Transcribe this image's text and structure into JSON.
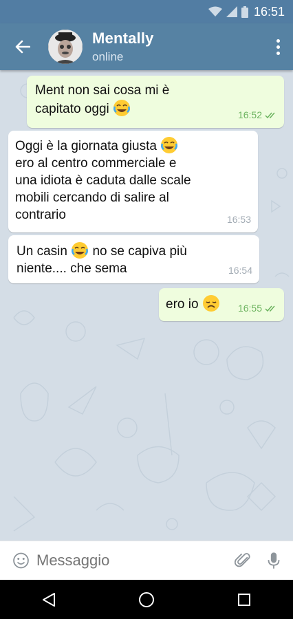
{
  "status_bar": {
    "time": "16:51"
  },
  "header": {
    "name": "Mentally",
    "status": "online"
  },
  "messages": [
    {
      "direction": "out",
      "line1": "Ment non sai cosa mi è",
      "line2": "capitato oggi",
      "emoji": "face-with-tears-of-joy",
      "time": "16:52",
      "read": true
    },
    {
      "direction": "in",
      "line1": "Oggi è la giornata giusta",
      "emoji": "face-with-tears-of-joy",
      "line2": "ero al centro commerciale e",
      "line3": "una idiota è caduta dalle scale",
      "line4": "mobili cercando di salire al",
      "line5": "contrario",
      "time": "16:53"
    },
    {
      "direction": "in",
      "line1a": "Un casin",
      "line1b": "no se capiva più",
      "emoji": "face-with-tears-of-joy",
      "line2": "niente.... che sema",
      "time": "16:54"
    },
    {
      "direction": "out",
      "line1": "ero io",
      "emoji": "disappointed-face",
      "time": "16:55",
      "read": true
    }
  ],
  "input": {
    "placeholder": "Messaggio"
  },
  "colors": {
    "header": "#5682a3",
    "status_bar": "#527da3",
    "outgoing_bubble": "#effdde",
    "incoming_bubble": "#ffffff",
    "chat_background": "#d4dde6",
    "read_check": "#6cb35f"
  },
  "icons": [
    "back-arrow-icon",
    "more-vert-icon",
    "emoji-icon",
    "attach-icon",
    "microphone-icon",
    "nav-back-icon",
    "nav-home-icon",
    "nav-recents-icon",
    "wifi-icon",
    "signal-icon",
    "battery-icon"
  ]
}
